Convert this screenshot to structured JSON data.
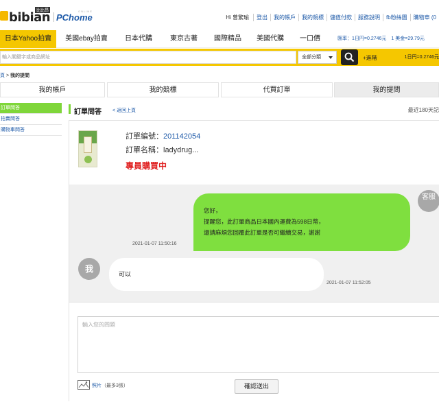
{
  "header": {
    "logo_text": "bibian",
    "logo_badge": "比比昂",
    "partner_logo": "PChome",
    "partner_tag": "ONLINE",
    "greeting": "Hi 曾繁瑜",
    "links": [
      "登出",
      "我的帳戶",
      "我的競標",
      "儲值付款",
      "服務說明",
      "fb粉絲團",
      "購物車 (0"
    ]
  },
  "nav": {
    "items": [
      "日本Yahoo拍賣",
      "美國ebay拍賣",
      "日本代購",
      "東京古著",
      "國際精品",
      "美國代購",
      "一口價"
    ],
    "active_index": 0,
    "rate_text": "匯率：1日円=0.2746元　1 美金=29.79元"
  },
  "search": {
    "placeholder": "輸入關鍵字或商品網址",
    "category": "全部分類",
    "advanced_label": "+進階",
    "rate_box": "1日円=0.2746元"
  },
  "breadcrumb": {
    "parent": "頁",
    "separator": ">",
    "current": "我的提問"
  },
  "tabs": [
    {
      "label": "我的帳戶"
    },
    {
      "label": "我的競標"
    },
    {
      "label": "代買訂單"
    },
    {
      "label": "我的提問"
    }
  ],
  "sidebar": {
    "items": [
      {
        "label": "訂單問答"
      },
      {
        "label": "拍賣問答"
      },
      {
        "label": "購物車問答"
      }
    ]
  },
  "main": {
    "title": "訂單問答",
    "back_link": "< 返回上頁",
    "recent_label": "最近180天記"
  },
  "order": {
    "number_label": "訂單編號：",
    "number": "201142054",
    "name_label": "訂單名稱：",
    "name": "ladydrug...",
    "status": "專員購買中"
  },
  "chat": {
    "cs_avatar": "客服",
    "me_avatar": "我",
    "message_right": {
      "line1": "您好，",
      "line2": "提醒您，此訂單商品日本國內運費為598日幣，",
      "line3": "還請麻煩您回覆此訂單是否可繼續交易，謝謝",
      "time": "2021-01-07 11:50:16"
    },
    "message_left": {
      "text": "可以",
      "time": "2021-01-07 11:52:05"
    }
  },
  "compose": {
    "placeholder": "輸入您的問題",
    "photo_label": "照片",
    "photo_note": "（最多3張）",
    "submit_label": "確認送出"
  }
}
